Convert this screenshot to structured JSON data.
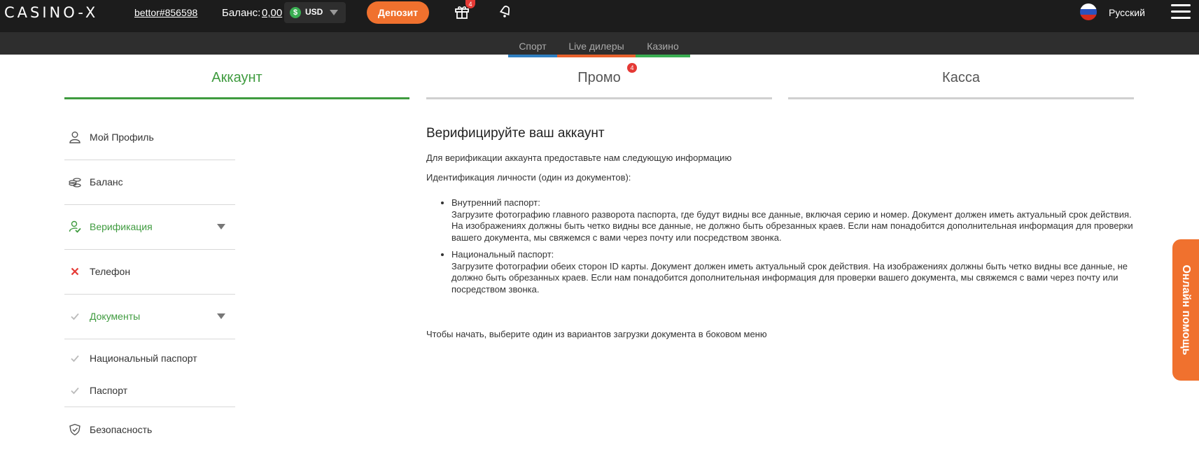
{
  "header": {
    "logo": "CASINO-X",
    "user_id": "bettor#856598",
    "balance_label": "Баланс:",
    "balance_value": "0,00",
    "currency": "USD",
    "currency_symbol": "$",
    "deposit_label": "Депозит",
    "gift_badge": "4",
    "language": "Русский",
    "icons": {
      "gift": "gift-icon",
      "notifications": "bell-icon",
      "menu": "hamburger-menu-icon",
      "flag": "russia-flag-icon"
    }
  },
  "subnav": {
    "items": [
      {
        "label": "Спорт",
        "color": "#2f7fc1"
      },
      {
        "label": "Live дилеры",
        "color": "#e8612c"
      },
      {
        "label": "Казино",
        "color": "#3aae52"
      }
    ]
  },
  "tabs": [
    {
      "label": "Аккаунт",
      "active": true
    },
    {
      "label": "Промо",
      "badge": "4"
    },
    {
      "label": "Касса"
    }
  ],
  "sidebar": {
    "items": [
      {
        "label": "Мой Профиль",
        "icon": "user-icon"
      },
      {
        "label": "Баланс",
        "icon": "coins-icon"
      },
      {
        "label": "Верификация",
        "icon": "user-check-icon",
        "expanded": true
      },
      {
        "label": "Телефон",
        "icon": "close-icon"
      },
      {
        "label": "Документы",
        "icon": "check-icon",
        "expanded": true
      },
      {
        "label": "Национальный паспорт",
        "icon": "check-icon"
      },
      {
        "label": "Паспорт",
        "icon": "check-icon"
      },
      {
        "label": "Безопасность",
        "icon": "shield-icon"
      }
    ]
  },
  "content": {
    "title": "Верифицируйте ваш аккаунт",
    "intro": "Для верификации аккаунта предоставьте нам следующую информацию",
    "id_label": "Идентификация личности (один из документов):",
    "documents": [
      {
        "name": "Внутренний паспорт:",
        "text": "Загрузите фотографию главного разворота паспорта, где будут видны все данные, включая серию и номер. Документ должен иметь актуальный срок действия. На изображениях должны быть четко видны все данные, не должно быть обрезанных краев. Если нам понадобится дополнительная информация для проверки вашего документа, мы свяжемся с вами через почту или посредством звонка."
      },
      {
        "name": "Национальный паспорт:",
        "text": "Загрузите фотографии обеих сторон ID карты. Документ должен иметь актуальный срок действия. На изображениях должны быть четко видны все данные, не должно быть обрезанных краев. Если нам понадобится дополнительная информация для проверки вашего документа, мы свяжемся с вами через почту или посредством звонка."
      }
    ],
    "footer": "Чтобы начать, выберите один из вариантов загрузки документа в боковом меню"
  },
  "help_widget": {
    "label": "Онлайн помощь"
  },
  "colors": {
    "accent_green": "#3f9b3f",
    "accent_orange": "#f0712e",
    "badge_red": "#e53935",
    "topbar": "#1c1c1c"
  }
}
